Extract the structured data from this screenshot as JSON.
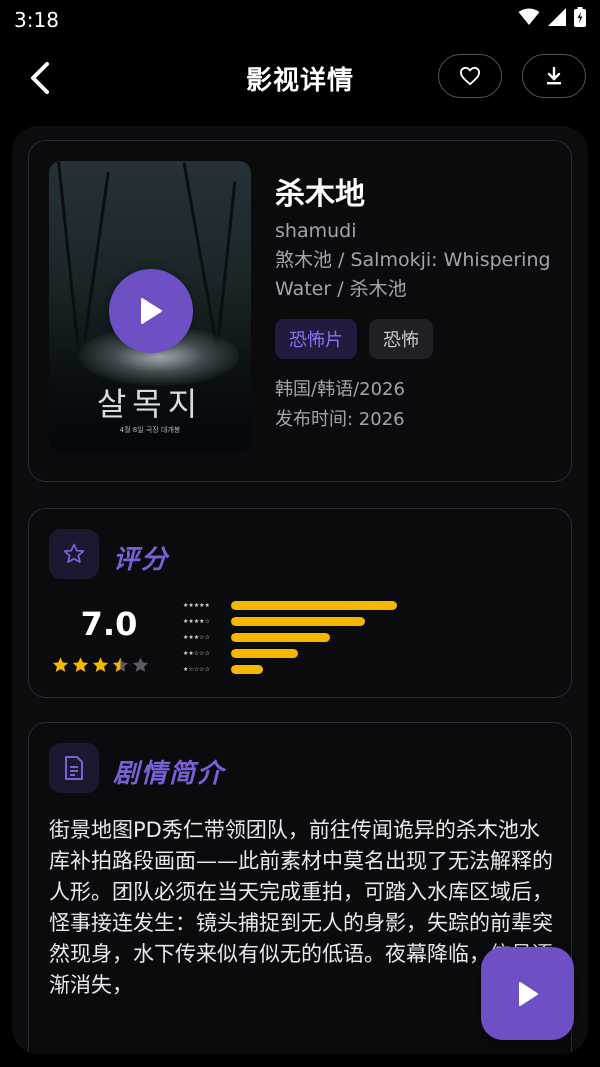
{
  "status": {
    "time": "3:18"
  },
  "header": {
    "title": "影视详情"
  },
  "movie": {
    "title": "杀木地",
    "alias": "shamudi\n煞木池 / Salmokji: Whispering Water / 杀木池",
    "tags": [
      "恐怖片",
      "恐怖"
    ],
    "region_lang_year": "韩国/韩语/2026",
    "release": "发布时间: 2026",
    "poster_title": "살목지",
    "poster_tagline": "4월 8일 극장 대개봉"
  },
  "rating": {
    "section_title": "评分",
    "score": "7.0",
    "stars": 3.5,
    "distribution": [
      {
        "stars": 5,
        "fraction": 0.77
      },
      {
        "stars": 4,
        "fraction": 0.62
      },
      {
        "stars": 3,
        "fraction": 0.46
      },
      {
        "stars": 2,
        "fraction": 0.31
      },
      {
        "stars": 1,
        "fraction": 0.15
      }
    ]
  },
  "plot": {
    "section_title": "剧情简介",
    "text": "街景地图PD秀仁带领团队，前往传闻诡异的杀木池水库补拍路段画面——此前素材中莫名出现了无法解释的人形。团队必须在当天完成重拍，可踏入水库区域后，怪事接连发生：镜头捕捉到无人的身影，失踪的前辈突然现身，水下传来似有似无的低语。夜幕降临，信号逐渐消失，"
  },
  "colors": {
    "accent": "#6e4fc4",
    "star": "#f5b700",
    "background": "#000000"
  }
}
